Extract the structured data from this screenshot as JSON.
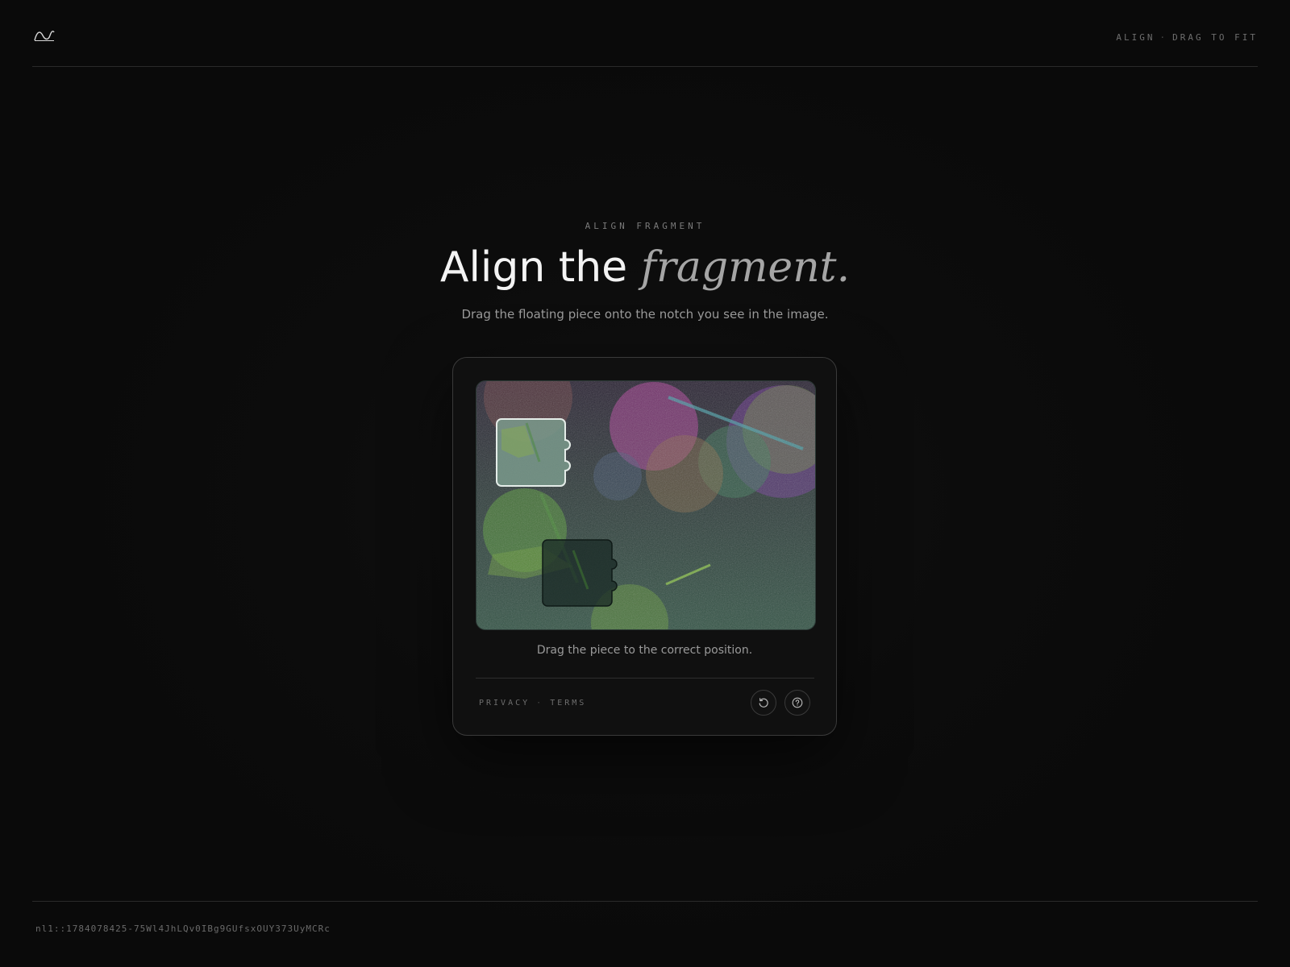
{
  "header": {
    "logo_icon": "wave-logo-icon",
    "status_primary": "ALIGN",
    "status_separator": "·",
    "status_secondary": "DRAG TO FIT"
  },
  "heading": {
    "eyebrow": "ALIGN FRAGMENT",
    "title_plain": "Align the",
    "title_accent": "fragment.",
    "subtitle": "Drag the floating piece onto the notch you see in the image."
  },
  "card": {
    "hint": "Drag the piece to the correct position.",
    "legal": {
      "privacy": "PRIVACY",
      "separator": "·",
      "terms": "TERMS"
    },
    "buttons": {
      "refresh_icon": "refresh-icon",
      "help_icon": "help-icon"
    }
  },
  "footer": {
    "session_id": "nl1::1784078425-75Wl4JhLQv0IBg9GUfsxOUY373UyMCRc"
  },
  "colors": {
    "background": "#0a0a0a",
    "card": "#101010",
    "accent_text": "#a5a5a5"
  }
}
